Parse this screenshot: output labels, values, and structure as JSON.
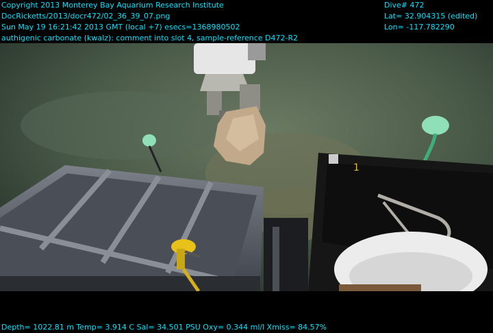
{
  "overlay": {
    "copyright": "Copyright 2013 Monterey Bay Aquarium Research Institute",
    "file_path": "DocRicketts/2013/docr472/02_36_39_07.png",
    "timestamp": "Sun May 19 16:21:42 2013 GMT (local +7)  esecs=1368980502",
    "annotation": "authigenic carbonate (kwalz): comment into slot 4, sample-reference D472-R2",
    "dive": "Dive# 472",
    "latitude": "Lat= 32.904315 (edited)",
    "longitude": "Lon= -117.782290",
    "sensors": "Depth= 1022.81 m  Temp= 3.914 C  Sal= 34.501 PSU  Oxy= 0.344 ml/l  Xmiss= 84.57%"
  },
  "colors": {
    "overlay_text": "#00e5ff",
    "seafloor": "#4a5a48",
    "tray": "#5c6068",
    "bin": "#161616",
    "cable_tag": "#e8c21a",
    "float_marker": "#8fe0b8"
  },
  "icons": {
    "bin_number": "1"
  }
}
